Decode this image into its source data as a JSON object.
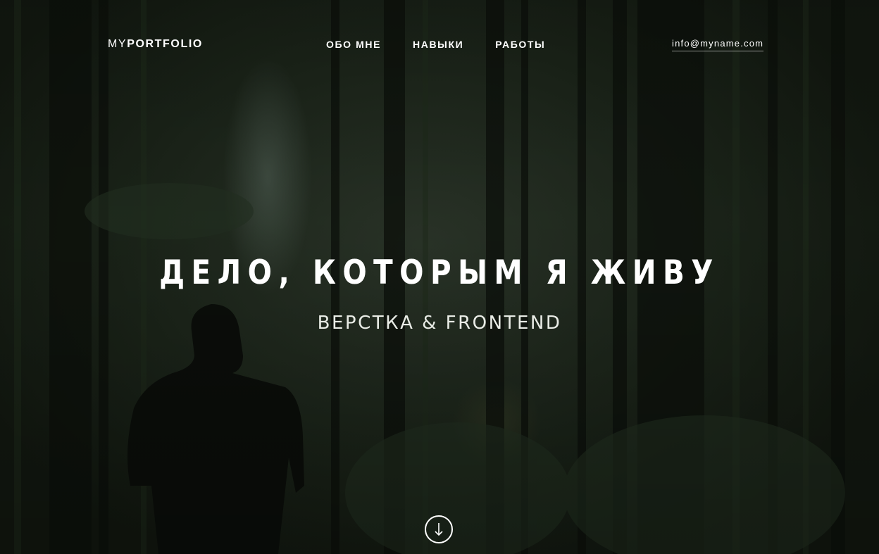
{
  "header": {
    "logo": {
      "light": "MY",
      "bold": "PORTFOLIO"
    },
    "nav": [
      {
        "label": "ОБО МНЕ"
      },
      {
        "label": "НАВЫКИ"
      },
      {
        "label": "РАБОТЫ"
      }
    ],
    "email": "info@myname.com"
  },
  "hero": {
    "title": "ДЕЛО, КОТОРЫМ Я ЖИВУ",
    "subtitle": "ВЕРСТКА & FRONTEND",
    "scroll_icon": "arrow-down-icon"
  },
  "colors": {
    "text": "#ffffff",
    "background_dark": "#131a12",
    "forest_mid": "#2b3529"
  }
}
